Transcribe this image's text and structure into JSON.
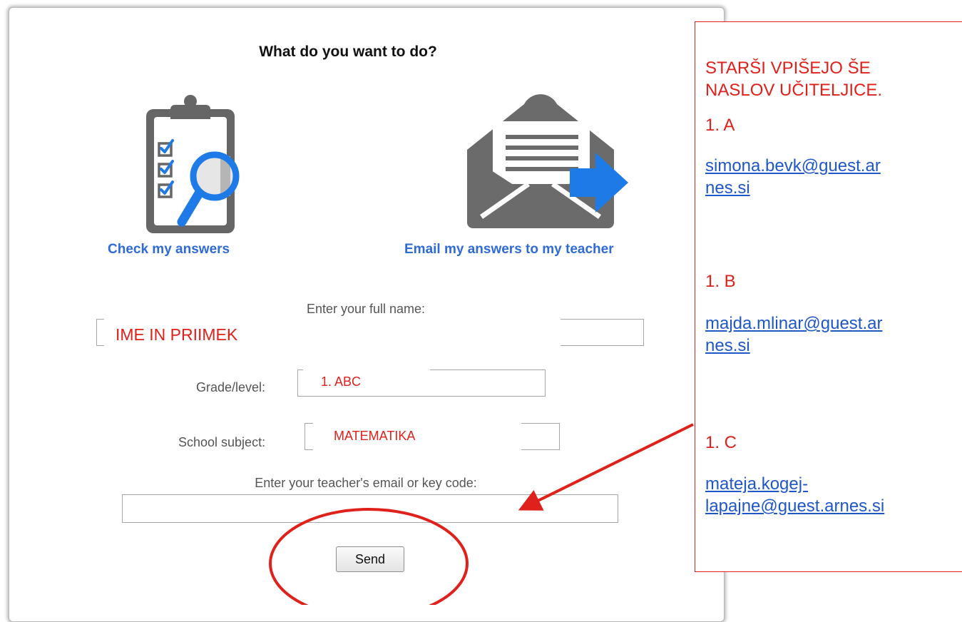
{
  "dialog": {
    "title": "What do you want to do?",
    "options": {
      "check_label": "Check my answers",
      "email_label": "Email my answers to my teacher"
    },
    "form": {
      "name_label": "Enter your full name:",
      "grade_label": "Grade/level:",
      "subject_label": "School subject:",
      "teacher_label": "Enter your teacher's email or key code:",
      "send_label": "Send"
    }
  },
  "overlays": {
    "name_value": "IME IN PRIIMEK",
    "grade_value": "1. ABC",
    "subject_value": "MATEMATIKA"
  },
  "panel": {
    "heading_line1": "STARŠI VPIŠEJO ŠE",
    "heading_line2": "NASLOV UČITELJICE.",
    "class_a": "1. A",
    "email_a_line1": "simona.bevk@guest.ar",
    "email_a_line2": "nes.si",
    "class_b": "1. B",
    "email_b_line1": "majda.mlinar@guest.ar",
    "email_b_line2": "nes.si",
    "class_c": "1. C",
    "email_c_line1": "mateja.kogej-",
    "email_c_line2": "lapajne@guest.arnes.si"
  },
  "colors": {
    "accent_blue": "#2f6bd6",
    "annotation_red": "#e0201b",
    "icon_gray": "#666666",
    "icon_blue": "#1e7ae6"
  },
  "icons": {
    "check": "clipboard-magnifier-icon",
    "email": "envelope-arrow-icon"
  }
}
